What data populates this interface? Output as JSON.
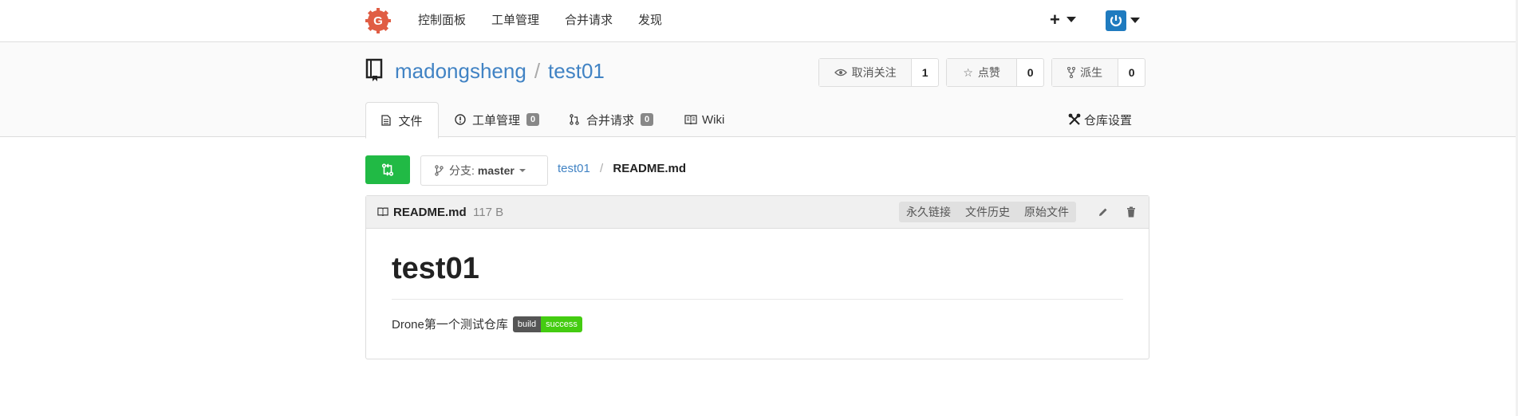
{
  "nav": {
    "items": [
      "控制面板",
      "工单管理",
      "合并请求",
      "发现"
    ],
    "plus": "+"
  },
  "repo": {
    "owner": "madongsheng",
    "separator": "/",
    "name": "test01"
  },
  "actions": {
    "unwatch_label": "取消关注",
    "unwatch_count": "1",
    "star_label": "点赞",
    "star_count": "0",
    "fork_label": "派生",
    "fork_count": "0"
  },
  "tabs": {
    "files": "文件",
    "issues": "工单管理",
    "issues_count": "0",
    "pulls": "合并请求",
    "pulls_count": "0",
    "wiki": "Wiki",
    "settings": "仓库设置"
  },
  "branch": {
    "label": "分支:",
    "name": "master"
  },
  "breadcrumb": {
    "repo": "test01",
    "sep": "/",
    "file": "README.md"
  },
  "file": {
    "name": "README.md",
    "size": "117 B",
    "permalink": "永久链接",
    "history": "文件历史",
    "raw": "原始文件"
  },
  "readme": {
    "heading": "test01",
    "text": "Drone第一个测试仓库",
    "badge_left": "build",
    "badge_right": "success"
  },
  "colors": {
    "link": "#4183c4",
    "accent_green": "#21ba45",
    "logo": "#e05d44",
    "avatar": "#1f7bbf"
  }
}
